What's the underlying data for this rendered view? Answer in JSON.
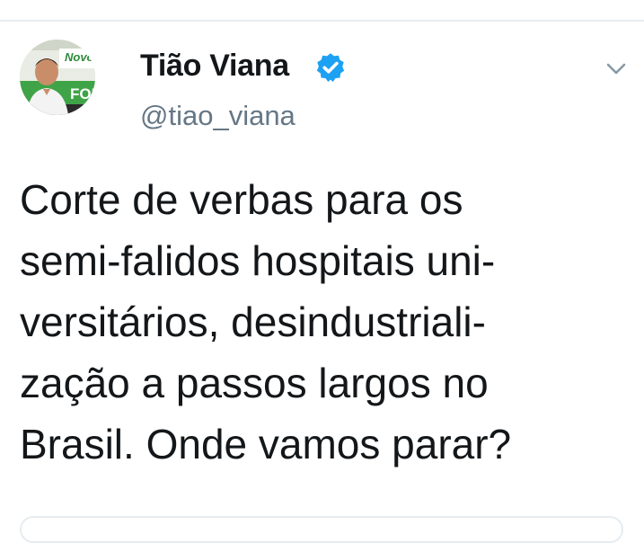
{
  "tweet": {
    "display_name": "Tião Viana",
    "handle": "@tiao_viana",
    "verified": true,
    "avatar_banner_text_top": "Novo",
    "avatar_banner_text_mid": "FOR",
    "text_lines": [
      "Corte de verbas para os",
      "semi-falidos hospitais uni-",
      "versitários, desindustriali-",
      "zação a passos largos no",
      "Brasil. Onde vamos parar?"
    ]
  },
  "icons": {
    "verified": "verified-badge-icon",
    "menu": "chevron-down-icon"
  },
  "colors": {
    "verified_blue": "#1da1f2",
    "text_primary": "#14171a",
    "text_secondary": "#657786",
    "divider": "#e6ecf0"
  }
}
